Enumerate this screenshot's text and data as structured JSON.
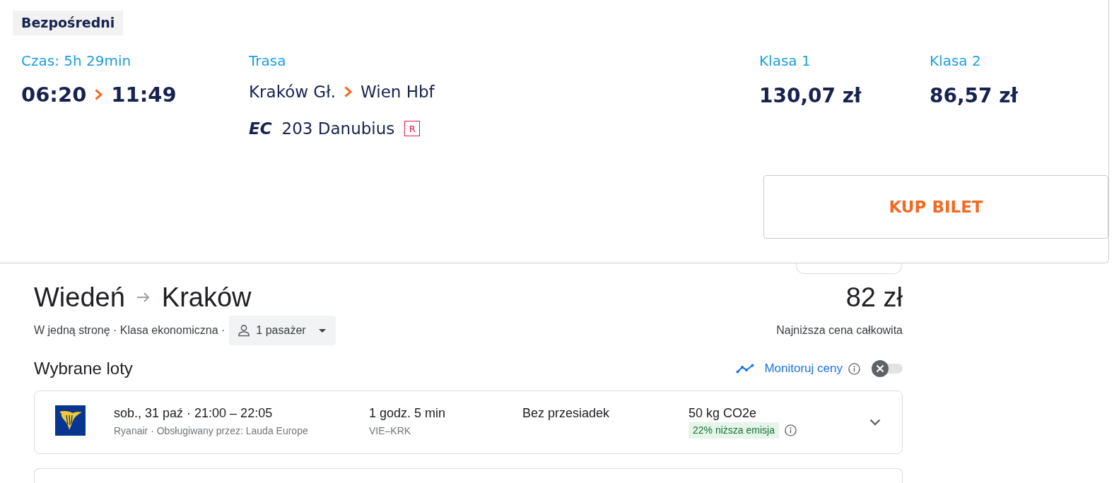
{
  "offer": {
    "badge": "Bezpośredni",
    "duration_label": "Czas: 5h 29min",
    "departure": "06:20",
    "arrival": "11:49",
    "route_label": "Trasa",
    "from_station": "Kraków Gł.",
    "to_station": "Wien Hbf",
    "train": {
      "category": "EC",
      "name": "203 Danubius",
      "reservation": "R"
    },
    "fares": [
      {
        "label": "Klasa 1",
        "price": "130,07 zł"
      },
      {
        "label": "Klasa 2",
        "price": "86,57 zł"
      }
    ],
    "buy_button": "KUP BILET"
  },
  "flights": {
    "origin": "Wiedeń",
    "destination": "Kraków",
    "price": "82 zł",
    "trip_summary": "W jedną stronę · Klasa ekonomiczna ·",
    "passengers": "1 pasażer",
    "price_note": "Najniższa cena całkowita",
    "section_title": "Wybrane loty",
    "price_tracking": {
      "label": "Monitoruj ceny",
      "on": false
    },
    "selected_flights": [
      {
        "schedule": "sob., 31 paź · 21:00 – 22:05",
        "carrier": "Ryanair · Obsługiwany przez: Lauda Europe",
        "duration": "1 godz. 5 min",
        "route": "VIE–KRK",
        "stops": "Bez przesiadek",
        "emissions": "50 kg CO2e",
        "emissions_note": "22% niższa emisja",
        "expanded": false
      }
    ]
  }
}
